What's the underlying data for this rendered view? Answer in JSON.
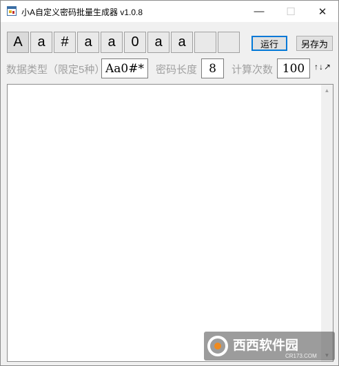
{
  "window": {
    "title": "小A自定义密码批量生成器 v1.0.8",
    "minimize_glyph": "—",
    "maximize_glyph": "☐",
    "close_glyph": "✕"
  },
  "pattern_cells": [
    "A",
    "a",
    "#",
    "a",
    "a",
    "0",
    "a",
    "a",
    "",
    ""
  ],
  "buttons": {
    "run": "运行",
    "save_as": "另存为"
  },
  "settings": {
    "data_type_label": "数据类型（限定5种）",
    "data_type_value": "Aa0#*",
    "length_label": "密码长度",
    "length_value": "8",
    "count_label": "计算次数",
    "count_value": "100",
    "resize_icon": "↑↓↗"
  },
  "output": {
    "text": ""
  },
  "watermark": {
    "brand": "西西软件园",
    "url": "CR173.COM"
  },
  "colors": {
    "accent": "#0078d7",
    "label_gray": "#a0a0a0",
    "watermark_orange": "#f08a1d"
  }
}
